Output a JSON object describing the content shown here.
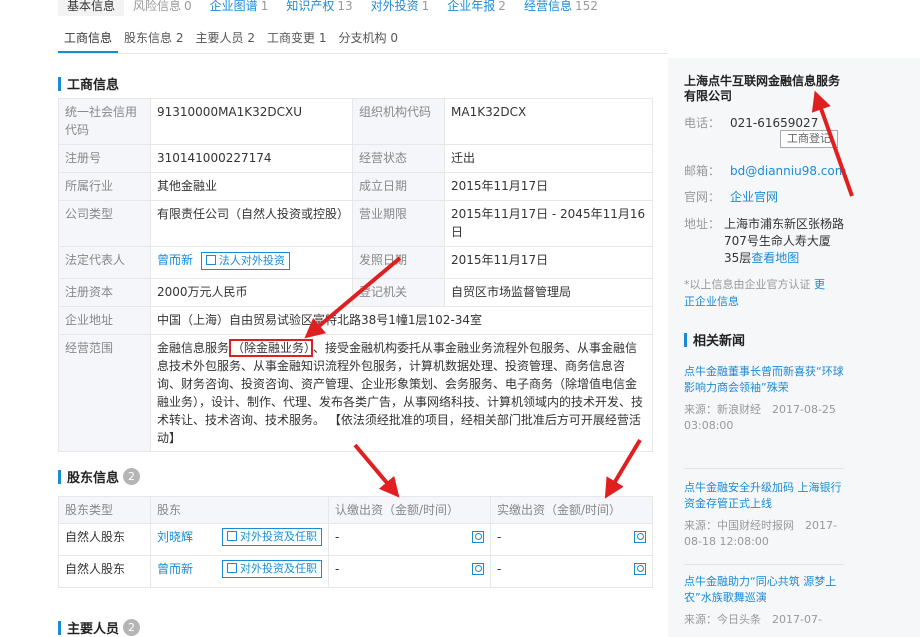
{
  "top_tabs": [
    {
      "label": "基本信息",
      "count": ""
    },
    {
      "label": "风险信息",
      "count": "0"
    },
    {
      "label": "企业图谱",
      "count": "1"
    },
    {
      "label": "知识产权",
      "count": "13"
    },
    {
      "label": "对外投资",
      "count": "1"
    },
    {
      "label": "企业年报",
      "count": "2"
    },
    {
      "label": "经营信息",
      "count": "152"
    }
  ],
  "sub_tabs": [
    {
      "label": "工商信息",
      "count": ""
    },
    {
      "label": "股东信息",
      "count": "2"
    },
    {
      "label": "主要人员",
      "count": "2"
    },
    {
      "label": "工商变更",
      "count": "1"
    },
    {
      "label": "分支机构",
      "count": "0"
    }
  ],
  "business_info": {
    "title": "工商信息",
    "uscc_label": "统一社会信用代码",
    "uscc": "91310000MA1K32DCXU",
    "org_code_label": "组织机构代码",
    "org_code": "MA1K32DCX",
    "reg_no_label": "注册号",
    "reg_no": "310141000227174",
    "status_label": "经营状态",
    "status": "迁出",
    "industry_label": "所属行业",
    "industry": "其他金融业",
    "founded_label": "成立日期",
    "founded": "2015年11月17日",
    "company_type_label": "公司类型",
    "company_type": "有限责任公司（自然人投资或控股）",
    "term_label": "营业期限",
    "term": "2015年11月17日 - 2045年11月16日",
    "legal_rep_label": "法定代表人",
    "legal_rep": "曾而新",
    "legal_rep_btn": "法人对外投资",
    "issue_date_label": "发照日期",
    "issue_date": "2015年11月17日",
    "capital_label": "注册资本",
    "capital": "2000万元人民币",
    "authority_label": "登记机关",
    "authority": "自贸区市场监督管理局",
    "address_label": "企业地址",
    "address": "中国（上海）自由贸易试验区富特北路38号1幢1层102-34室",
    "scope_label": "经营范围",
    "scope_pre": "金融信息服务",
    "scope_highlight": "（除金融业务）",
    "scope_post": "、接受金融机构委托从事金融业务流程外包服务、从事金融信息技术外包服务、从事金融知识流程外包服务，计算机数据处理、投资管理、商务信息咨询、财务咨询、投资咨询、资产管理、企业形象策划、会务服务、电子商务（除增值电信金融业务），设计、制作、代理、发布各类广告，从事网络科技、计算机领域内的技术开发、技术转让、技术咨询、技术服务。 【依法须经批准的项目，经相关部门批准后方可开展经营活动】"
  },
  "shareholders": {
    "title": "股东信息",
    "count": "2",
    "headers": [
      "股东类型",
      "股东",
      "认缴出资（金额/时间）",
      "实缴出资（金额/时间）"
    ],
    "rows": [
      {
        "type": "自然人股东",
        "name": "刘晓辉",
        "btn": "对外投资及任职",
        "subscribed": "-",
        "paid": "-"
      },
      {
        "type": "自然人股东",
        "name": "曾而新",
        "btn": "对外投资及任职",
        "subscribed": "-",
        "paid": "-"
      }
    ]
  },
  "key_people": {
    "title": "主要人员",
    "count": "2"
  },
  "sidebar": {
    "company_name": "上海点牛互联网金融信息服务有限公司",
    "phone_label": "电话：",
    "phone": "021-61659027",
    "registry_btn": "工商登记",
    "email_label": "邮箱：",
    "email": "bd@dianniu98.com",
    "site_label": "官网：",
    "site": "企业官网",
    "address_label": "地址：",
    "address": "上海市浦东新区张杨路707号生命人寿大厦35层",
    "map_link": "查看地图",
    "note": "*以上信息由企业官方认证",
    "note_link": "更正企业信息",
    "news_title": "相关新闻",
    "news": [
      {
        "title": "点牛金融董事长曾而新喜获“环球影响力商会领袖”殊荣",
        "meta": "来源：新浪财经　2017-08-25 03:08:00"
      },
      {
        "title": "点牛金融安全升级加码 上海银行资金存管正式上线",
        "meta": "来源：中国财经时报网　2017-08-18 12:08:00"
      },
      {
        "title": "点牛金融助力“同心共筑 源梦上农”水族歌舞巡演",
        "meta": "来源：今日头条　2017-07-"
      }
    ]
  },
  "colors": {
    "accent": "#1b8bd6",
    "annotation": "#e02020"
  }
}
